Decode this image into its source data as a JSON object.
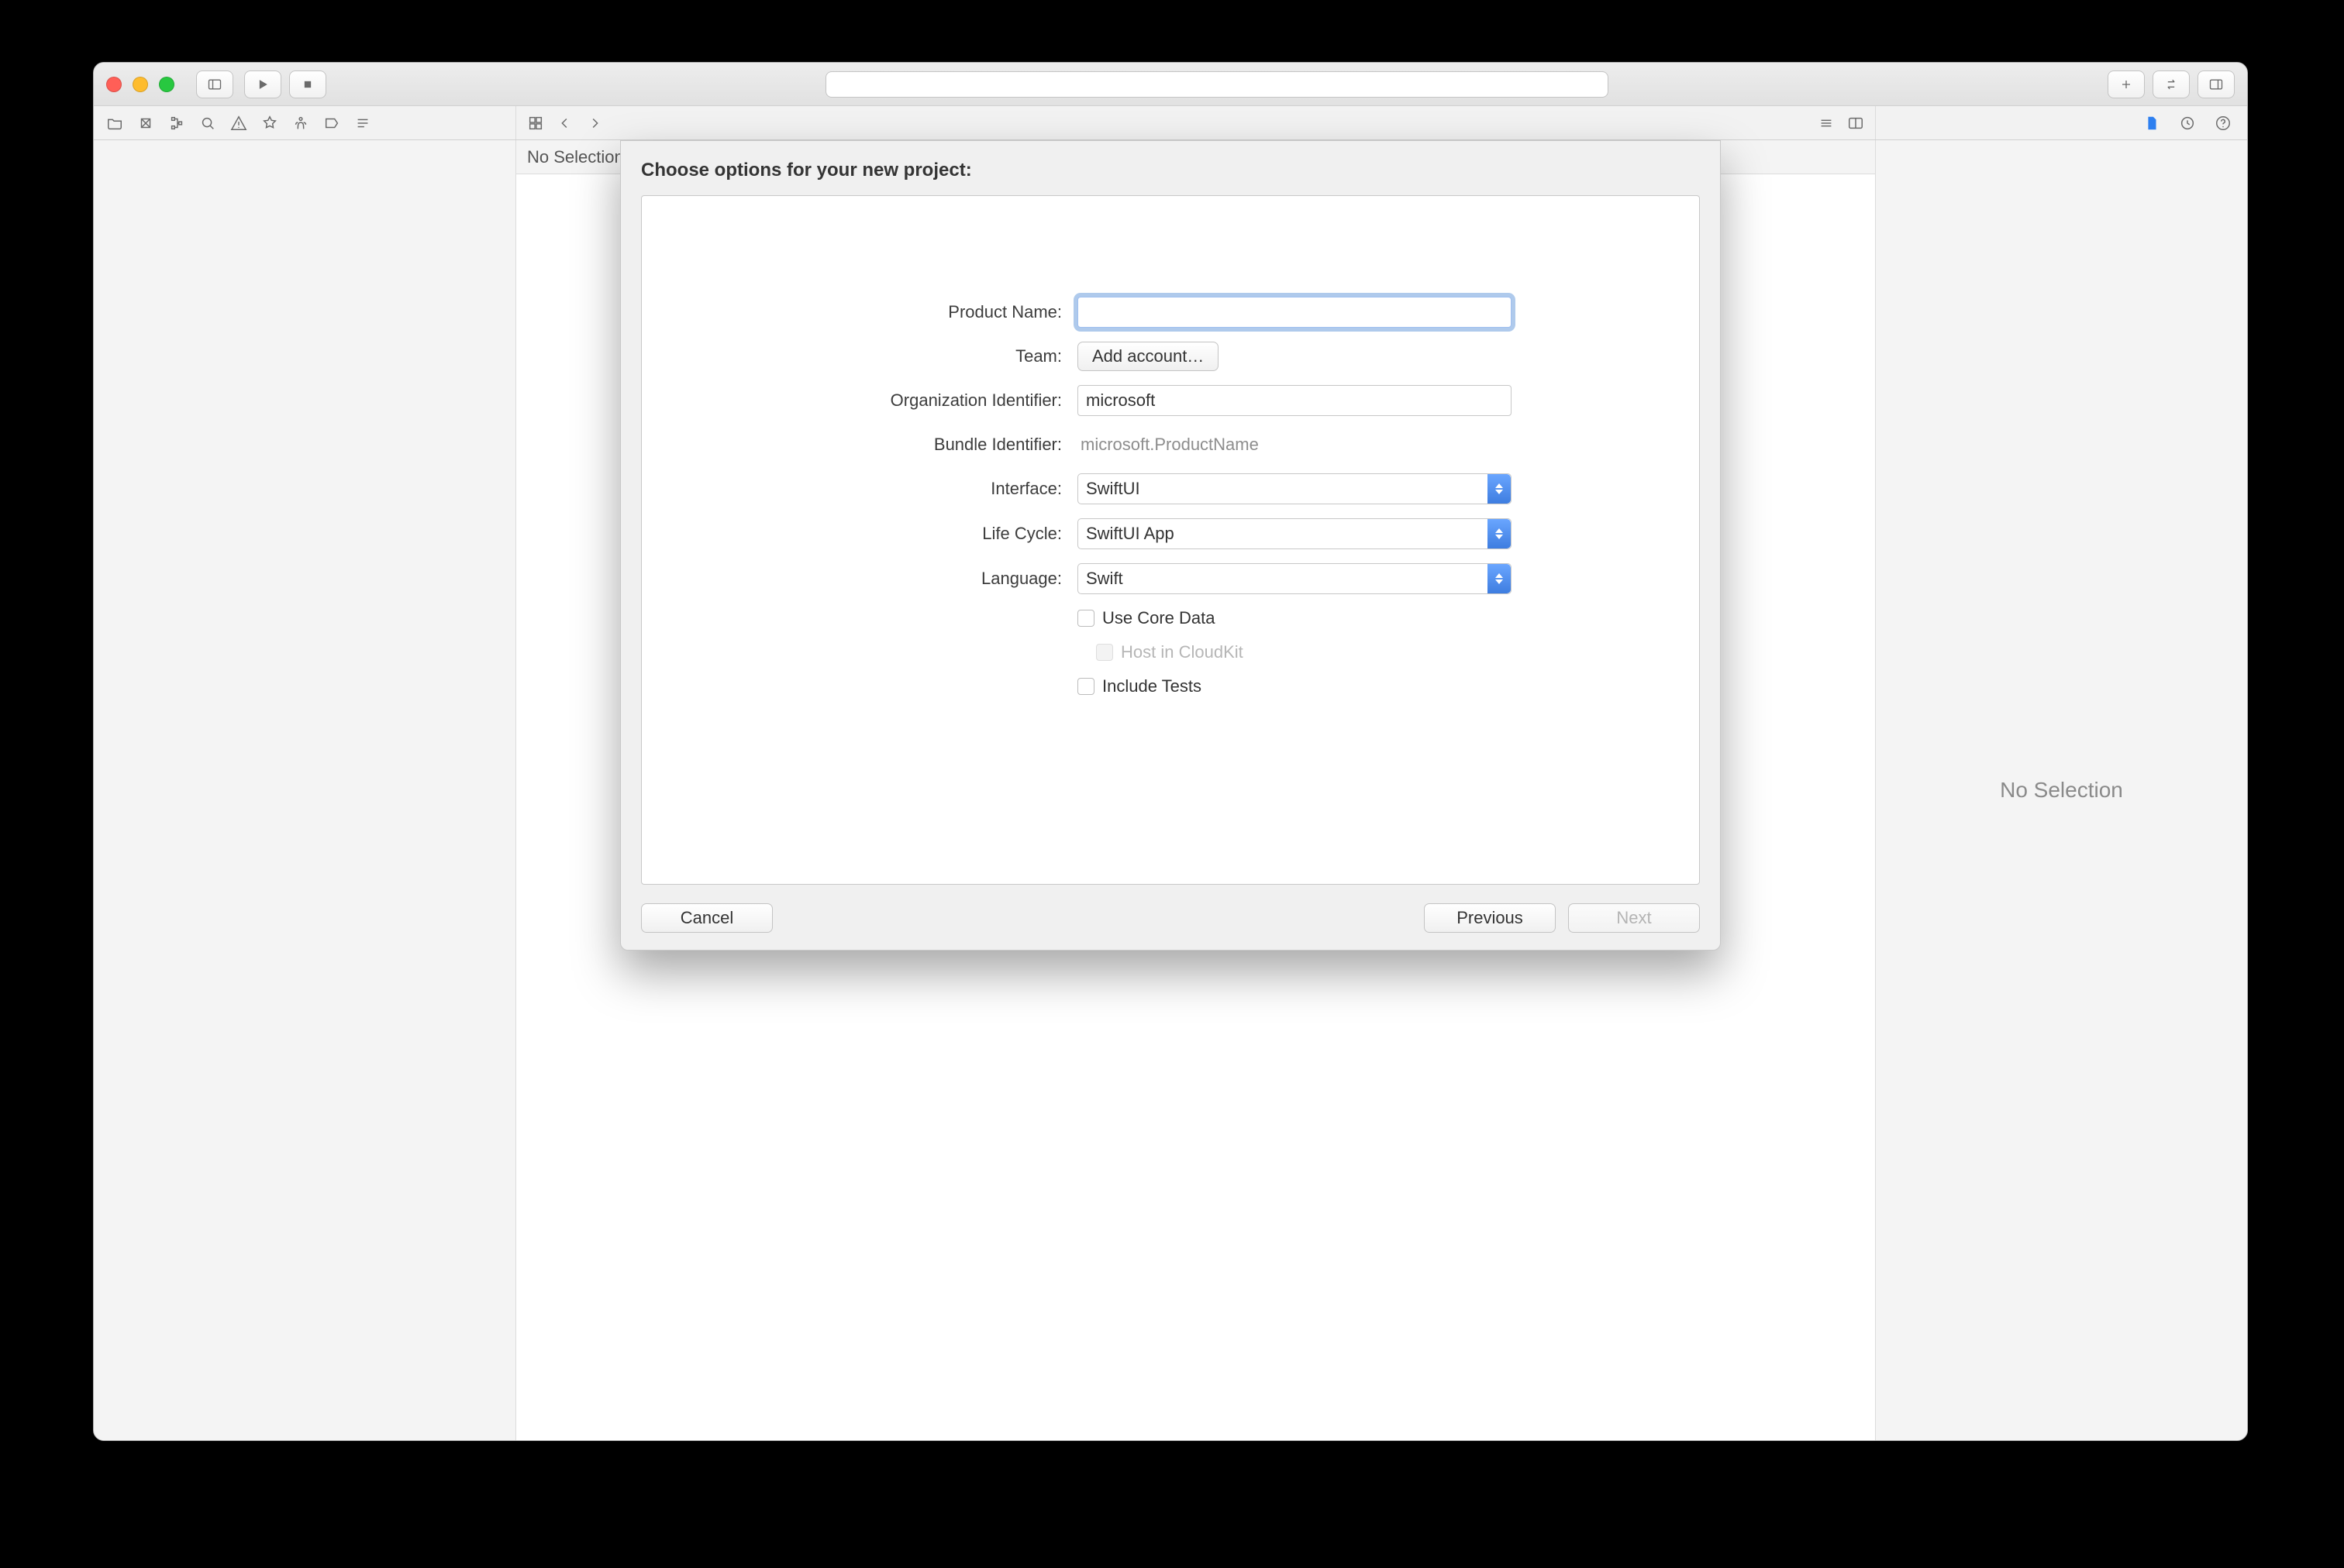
{
  "titlebar": {
    "close": "close",
    "min": "minimize",
    "zoom": "zoom"
  },
  "toolbar_right": {
    "add": "plus-icon",
    "review": "review-icon",
    "panels": "panel-toggle-icon"
  },
  "mid": {
    "status": "No Selection"
  },
  "inspector": {
    "nosel": "No Selection"
  },
  "sheet": {
    "title": "Choose options for your new project:",
    "labels": {
      "product": "Product Name:",
      "team": "Team:",
      "org": "Organization Identifier:",
      "bundle": "Bundle Identifier:",
      "iface": "Interface:",
      "life": "Life Cycle:",
      "lang": "Language:"
    },
    "values": {
      "product": "",
      "team_btn": "Add account…",
      "org": "microsoft",
      "bundle": "microsoft.ProductName",
      "iface": "SwiftUI",
      "life": "SwiftUI App",
      "lang": "Swift"
    },
    "checks": {
      "coredata": "Use Core Data",
      "cloudkit": "Host in CloudKit",
      "tests": "Include Tests"
    },
    "buttons": {
      "cancel": "Cancel",
      "prev": "Previous",
      "next": "Next"
    }
  }
}
